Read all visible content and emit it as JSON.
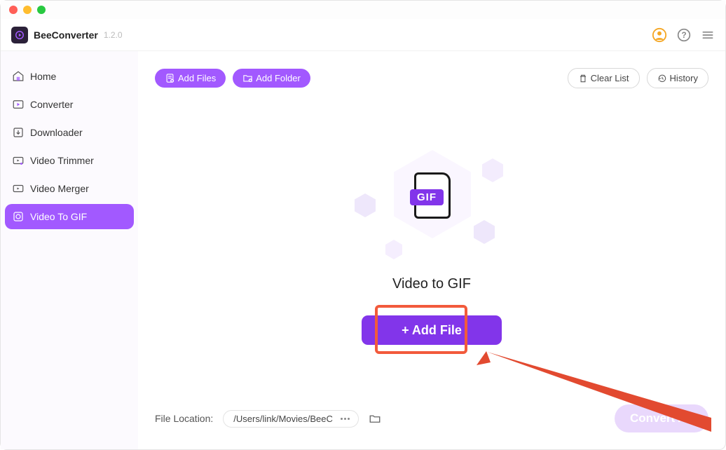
{
  "app": {
    "name": "BeeConverter",
    "version": "1.2.0"
  },
  "sidebar": {
    "items": [
      {
        "label": "Home"
      },
      {
        "label": "Converter"
      },
      {
        "label": "Downloader"
      },
      {
        "label": "Video Trimmer"
      },
      {
        "label": "Video Merger"
      },
      {
        "label": "Video To GIF"
      }
    ]
  },
  "toolbar": {
    "addFiles": "Add Files",
    "addFolder": "Add Folder",
    "clearList": "Clear List",
    "history": "History"
  },
  "main": {
    "gifBadge": "GIF",
    "title": "Video to GIF",
    "addFile": "+ Add File"
  },
  "bottom": {
    "label": "File Location:",
    "path": "/Users/link/Movies/BeeC",
    "convertAll": "Convert All"
  }
}
